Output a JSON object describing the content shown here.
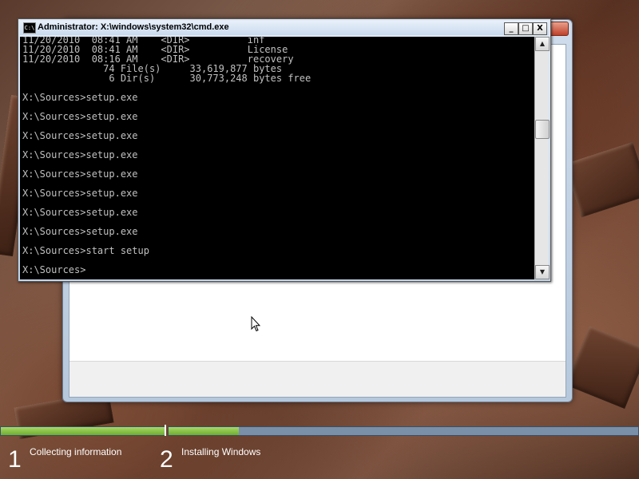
{
  "cmd_window": {
    "title": "Administrator: X:\\windows\\system32\\cmd.exe",
    "icon": "cmd-icon",
    "buttons": {
      "minimize": "_",
      "maximize": "□",
      "close": "X"
    },
    "console_lines": [
      "11/20/2010  08:41 AM    <DIR>          inf",
      "11/20/2010  08:41 AM    <DIR>          License",
      "11/20/2010  08:16 AM    <DIR>          recovery",
      "              74 File(s)     33,619,877 bytes",
      "               6 Dir(s)      30,773,248 bytes free",
      "",
      "X:\\Sources>setup.exe",
      "",
      "X:\\Sources>setup.exe",
      "",
      "X:\\Sources>setup.exe",
      "",
      "X:\\Sources>setup.exe",
      "",
      "X:\\Sources>setup.exe",
      "",
      "X:\\Sources>setup.exe",
      "",
      "X:\\Sources>setup.exe",
      "",
      "X:\\Sources>setup.exe",
      "",
      "X:\\Sources>start setup",
      "",
      "X:\\Sources>"
    ],
    "scrollbar": {
      "up": "▲",
      "down": "▼"
    }
  },
  "progress": {
    "step1_fill": 1.0,
    "step2_fill": 0.15,
    "fill_color": "#7dbb3a"
  },
  "steps": [
    {
      "number": "1",
      "label": "Collecting information"
    },
    {
      "number": "2",
      "label": "Installing Windows"
    }
  ]
}
